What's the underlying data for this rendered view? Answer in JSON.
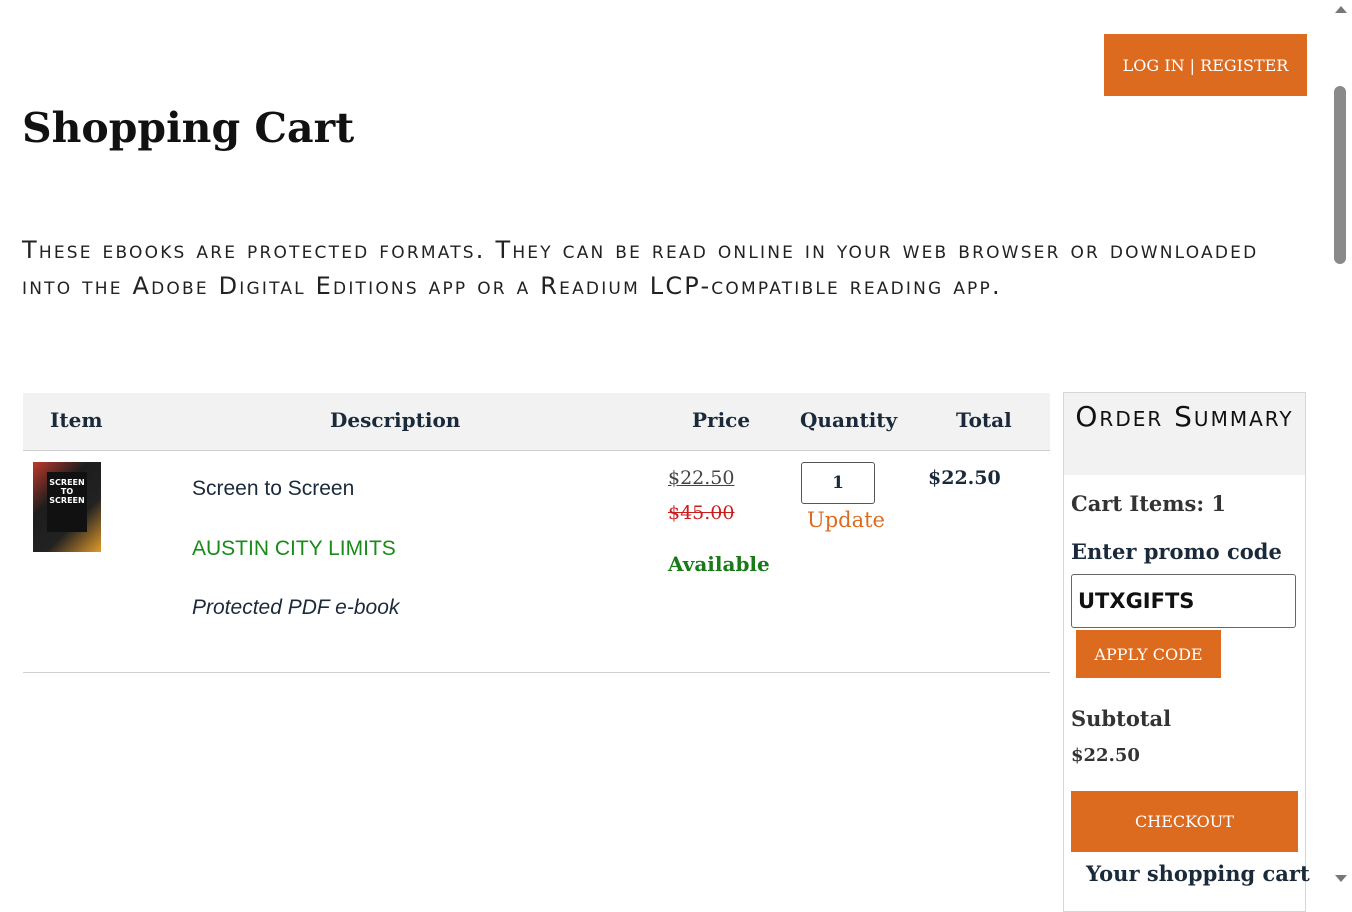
{
  "header": {
    "login_register_label": "LOG IN | REGISTER"
  },
  "page": {
    "title": "Shopping Cart",
    "notice": "These ebooks are protected formats. They can be read online in your web browser or downloaded into the Adobe Digital Editions app or a Readium LCP-compatible reading app."
  },
  "cart": {
    "columns": [
      "Item",
      "Description",
      "Price",
      "Quantity",
      "Total"
    ],
    "items": [
      {
        "cover_text": "SCREEN TO SCREEN",
        "title": "Screen to Screen",
        "publisher": "AUSTIN CITY LIMITS",
        "format": "Protected PDF e-book",
        "sale_price": "$22.50",
        "list_price": "$45.00",
        "availability": "Available",
        "quantity": "1",
        "update_label": "Update",
        "total": "$22.50"
      }
    ]
  },
  "summary": {
    "title": "Order Summary",
    "cart_items_label": "Cart Items: 1",
    "promo_label": "Enter promo code",
    "promo_value": "UTXGIFTS",
    "apply_label": "APPLY CODE",
    "subtotal_label": "Subtotal",
    "subtotal_value": "$22.50",
    "checkout_label": "CHECKOUT",
    "note": "Your shopping cart"
  },
  "colors": {
    "accent": "#dd6b1f",
    "available": "#1a7a1a",
    "strike": "#cc1d1d"
  }
}
